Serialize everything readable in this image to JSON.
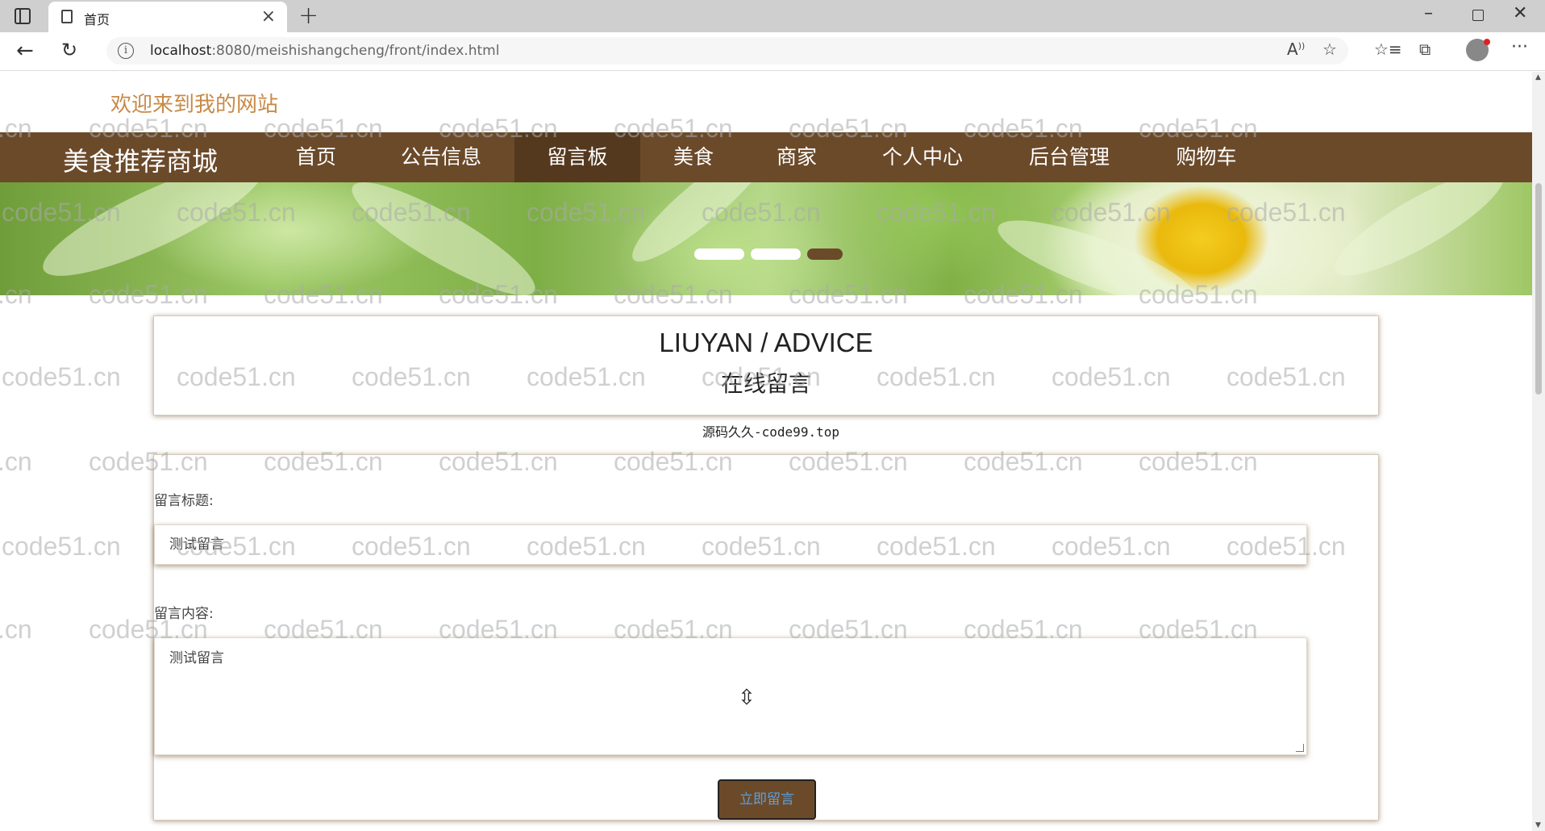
{
  "browser": {
    "tab_title": "首页",
    "tab_close": "×",
    "new_tab": "+",
    "url_host": "localhost",
    "url_rest": ":8080/meishishangcheng/front/index.html",
    "window_min": "–",
    "window_close": "✕"
  },
  "site": {
    "welcome": "欢迎来到我的网站",
    "brand": "美食推荐商城",
    "nav": [
      "首页",
      "公告信息",
      "留言板",
      "美食",
      "商家",
      "个人中心",
      "后台管理",
      "购物车"
    ],
    "active_nav_index": 2,
    "banner_active_dot": 3
  },
  "section": {
    "en_title": "LIUYAN / ADVICE",
    "cn_title": "在线留言",
    "source_note": "源码久久-code99.top"
  },
  "form": {
    "title_label": "留言标题:",
    "title_value": "测试留言",
    "content_label": "留言内容:",
    "content_value": "测试留言",
    "submit_label": "立即留言"
  },
  "watermark_text": "code51.cn",
  "colors": {
    "nav_bg": "#6b4a2a",
    "nav_active": "#54391f",
    "welcome_text": "#c88a47",
    "button_text": "#5aa0e0"
  }
}
